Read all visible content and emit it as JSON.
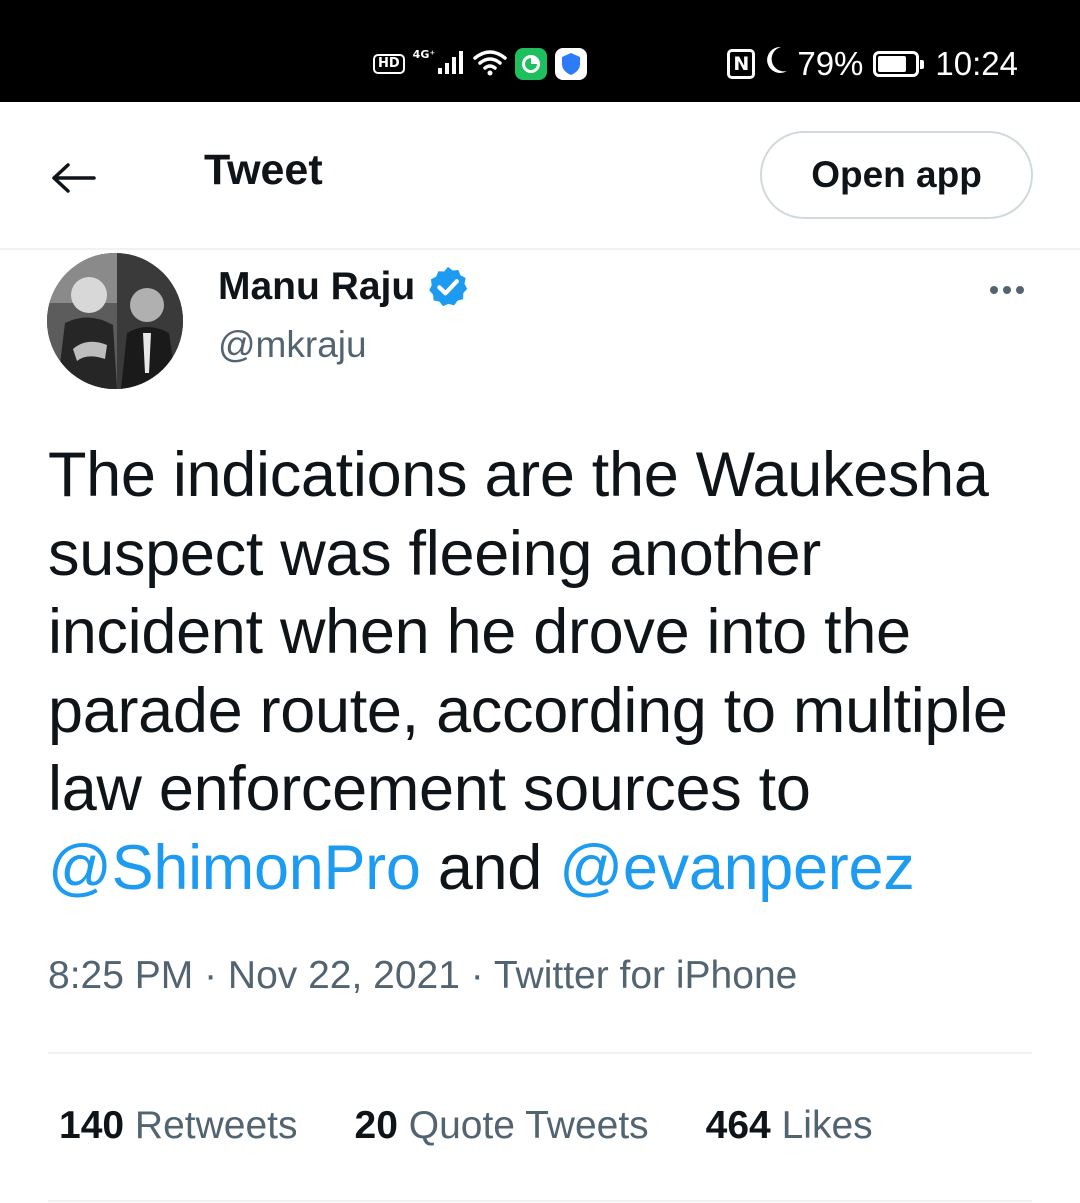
{
  "status_bar": {
    "hd": "HD",
    "network": "4G⁺",
    "battery_percent": "79%",
    "battery_level": 0.79,
    "time": "10:24",
    "icons": [
      "signal-icon",
      "wifi-icon",
      "app-icon-green",
      "shield-app-icon",
      "nfc-icon",
      "moon-icon",
      "battery-icon"
    ]
  },
  "header": {
    "title": "Tweet",
    "open_app_label": "Open app"
  },
  "tweet": {
    "author_name": "Manu Raju",
    "author_handle": "@mkraju",
    "verified": true,
    "text_parts": [
      "The indications are the Waukesha suspect was fleeing another incident when he drove into the parade route, according to multiple law enforcement sources to ",
      "@ShimonPro",
      " and ",
      "@evanperez"
    ],
    "meta": "8:25 PM · Nov 22, 2021 · Twitter for iPhone",
    "stats": {
      "retweets_count": "140",
      "retweets_label": "Retweets",
      "quotes_count": "20",
      "quotes_label": "Quote Tweets",
      "likes_count": "464",
      "likes_label": "Likes"
    }
  },
  "colors": {
    "link": "#1d9bf0",
    "secondary_text": "#536471",
    "primary_text": "#0f1419",
    "verified": "#1d9bf0"
  }
}
